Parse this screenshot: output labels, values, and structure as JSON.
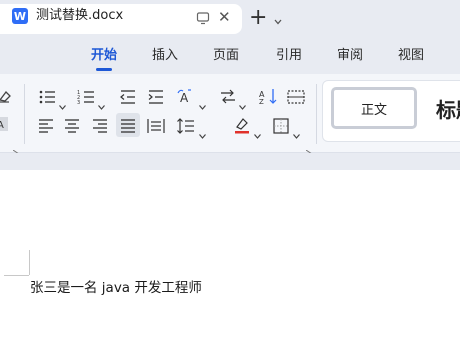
{
  "window": {
    "doc_tab_title": "测试替换.docx",
    "app_logo_letter": "W"
  },
  "menu": {
    "tabs": [
      {
        "label": "开始",
        "active": true
      },
      {
        "label": "插入",
        "active": false
      },
      {
        "label": "页面",
        "active": false
      },
      {
        "label": "引用",
        "active": false
      },
      {
        "label": "审阅",
        "active": false
      },
      {
        "label": "视图",
        "active": false
      }
    ]
  },
  "styles_gallery": {
    "normal_label": "正文",
    "heading_label": "标题"
  },
  "document": {
    "body_text": "张三是一名 java 开发工程师"
  },
  "colors": {
    "accent": "#1e58d6",
    "chrome": "#e8ebf2",
    "ribbon": "#f4f6fa"
  }
}
